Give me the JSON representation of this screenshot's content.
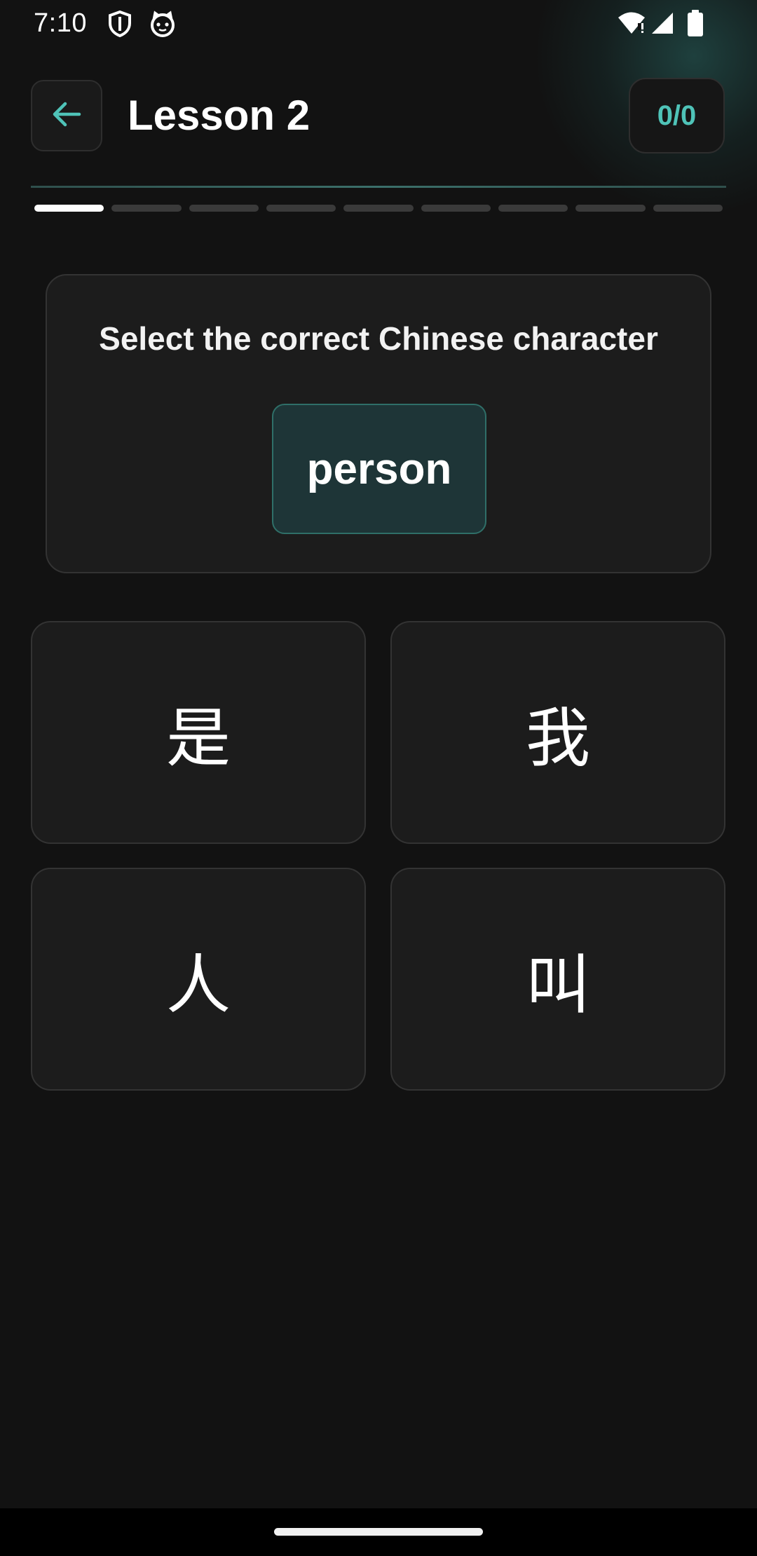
{
  "status_bar": {
    "time": "7:10",
    "icons": [
      "shield-icon",
      "cat-icon",
      "wifi-icon",
      "signal-icon",
      "battery-icon"
    ]
  },
  "header": {
    "back_icon": "arrow-left-icon",
    "title": "Lesson 2",
    "score": "0/0"
  },
  "progress": {
    "total_steps": 9,
    "current_step": 1
  },
  "prompt": {
    "instruction": "Select the correct Chinese character",
    "word": "person"
  },
  "options": [
    {
      "label": "是"
    },
    {
      "label": "我"
    },
    {
      "label": "人"
    },
    {
      "label": "叫"
    }
  ],
  "colors": {
    "background": "#121212",
    "accent": "#4fc3b8",
    "card": "#1c1c1c",
    "highlight_card": "#1e3537"
  }
}
